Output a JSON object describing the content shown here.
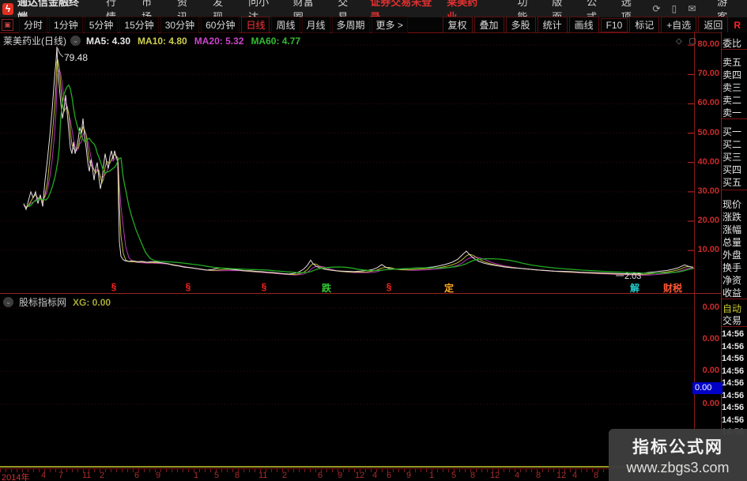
{
  "menubar": {
    "brand": "通达信金融终端",
    "items": [
      "行情",
      "市场",
      "资讯",
      "发现",
      "问小达",
      "财富圈",
      "交易"
    ],
    "status_trade": "证券交易未登录",
    "status_stock": "莱美药业",
    "right_items": [
      "功能",
      "版面",
      "公式",
      "选项"
    ],
    "icons": [
      {
        "name": "refresh-icon",
        "glyph": "⟳"
      },
      {
        "name": "phone-icon",
        "glyph": "▯"
      },
      {
        "name": "mail-icon",
        "glyph": "✉"
      }
    ],
    "user": "游客",
    "logo_glyph": "ϟ"
  },
  "toolbar": {
    "left_icon_glyph": "▣",
    "periods": [
      "分时",
      "1分钟",
      "5分钟",
      "15分钟",
      "30分钟",
      "60分钟",
      "日线",
      "周线",
      "月线",
      "多周期",
      "更多 >"
    ],
    "active_period": "日线",
    "buttons": [
      "复权",
      "叠加",
      "多股",
      "统计",
      "画线",
      "F10",
      "标记",
      "+自选",
      "返回"
    ],
    "r_badge": "R"
  },
  "chart": {
    "title": "莱美药业(日线)",
    "ma": [
      {
        "label": "MA5: 4.30",
        "color": "#e8e8e8"
      },
      {
        "label": "MA10: 4.80",
        "color": "#cfcf4f"
      },
      {
        "label": "MA20: 5.32",
        "color": "#cc44cc"
      },
      {
        "label": "MA60: 4.77",
        "color": "#33bb33"
      }
    ],
    "peak_label": "79.48",
    "low_label": "2.03",
    "y_ticks": [
      80,
      70,
      60,
      50,
      40,
      30,
      20,
      10
    ],
    "markers": [
      {
        "t": "§",
        "x": 144,
        "c": "#ff2222"
      },
      {
        "t": "§",
        "x": 238,
        "c": "#ff2222"
      },
      {
        "t": "§",
        "x": 334,
        "c": "#ff2222"
      },
      {
        "t": "跌",
        "x": 413,
        "c": "#33cc33"
      },
      {
        "t": "§",
        "x": 492,
        "c": "#ff2222"
      },
      {
        "t": "定",
        "x": 568,
        "c": "#ffaa22"
      },
      {
        "t": "解",
        "x": 803,
        "c": "#22cccc"
      },
      {
        "t": "财税",
        "x": 851,
        "c": "#ff5533"
      }
    ],
    "chart_data": {
      "type": "line",
      "title": "莱美药业 日线 close price",
      "ylim": [
        0,
        84
      ],
      "y_gridlines": [
        80,
        70,
        60,
        50,
        40,
        30,
        20,
        10
      ],
      "annotations": [
        {
          "text": "79.48",
          "x": 72
        },
        {
          "text": "2.03",
          "x": 806
        }
      ],
      "series": [
        {
          "name": "close",
          "points": [
            [
              30,
              26
            ],
            [
              33,
              24
            ],
            [
              36,
              27
            ],
            [
              39,
              30
            ],
            [
              42,
              28
            ],
            [
              45,
              30
            ],
            [
              48,
              26
            ],
            [
              51,
              29
            ],
            [
              54,
              25
            ],
            [
              57,
              34
            ],
            [
              60,
              41
            ],
            [
              63,
              49
            ],
            [
              66,
              58
            ],
            [
              69,
              69
            ],
            [
              71,
              75
            ],
            [
              72,
              79.5
            ],
            [
              73,
              72
            ],
            [
              75,
              66
            ],
            [
              77,
              60
            ],
            [
              79,
              55
            ],
            [
              81,
              58
            ],
            [
              83,
              63
            ],
            [
              85,
              57
            ],
            [
              87,
              51
            ],
            [
              89,
              45
            ],
            [
              91,
              43
            ],
            [
              93,
              47
            ],
            [
              95,
              43
            ],
            [
              97,
              45
            ],
            [
              99,
              48
            ],
            [
              101,
              52
            ],
            [
              103,
              50
            ],
            [
              105,
              55
            ],
            [
              107,
              49
            ],
            [
              109,
              45
            ],
            [
              111,
              40
            ],
            [
              113,
              37
            ],
            [
              115,
              41
            ],
            [
              117,
              38
            ],
            [
              119,
              34
            ],
            [
              121,
              38
            ],
            [
              123,
              40
            ],
            [
              125,
              35
            ],
            [
              127,
              31
            ],
            [
              129,
              34
            ],
            [
              131,
              39
            ],
            [
              133,
              43
            ],
            [
              135,
              40
            ],
            [
              137,
              38
            ],
            [
              139,
              42
            ],
            [
              141,
              44
            ],
            [
              143,
              41
            ],
            [
              145,
              44
            ],
            [
              147,
              42
            ],
            [
              149,
              40
            ],
            [
              150,
              25
            ],
            [
              151,
              13
            ],
            [
              153,
              8
            ],
            [
              156,
              6.8
            ],
            [
              159,
              6.4
            ],
            [
              163,
              6.3
            ],
            [
              168,
              6.5
            ],
            [
              174,
              6.2
            ],
            [
              180,
              6.3
            ],
            [
              186,
              6.0
            ],
            [
              192,
              6.2
            ],
            [
              198,
              6.1
            ],
            [
              205,
              5.8
            ],
            [
              212,
              5.5
            ],
            [
              219,
              5.0
            ],
            [
              226,
              4.7
            ],
            [
              233,
              4.3
            ],
            [
              240,
              4.2
            ],
            [
              247,
              3.9
            ],
            [
              254,
              3.6
            ],
            [
              261,
              3.3
            ],
            [
              268,
              3.5
            ],
            [
              275,
              3.9
            ],
            [
              282,
              4.0
            ],
            [
              289,
              3.7
            ],
            [
              296,
              3.5
            ],
            [
              303,
              3.3
            ],
            [
              310,
              3.1
            ],
            [
              317,
              3.1
            ],
            [
              324,
              2.9
            ],
            [
              331,
              2.8
            ],
            [
              338,
              2.6
            ],
            [
              345,
              2.5
            ],
            [
              352,
              2.3
            ],
            [
              359,
              2.1
            ],
            [
              366,
              2.0
            ],
            [
              372,
              2.2
            ],
            [
              378,
              2.7
            ],
            [
              384,
              3.6
            ],
            [
              389,
              5.0
            ],
            [
              393,
              6.7
            ],
            [
              396,
              5.5
            ],
            [
              400,
              4.6
            ],
            [
              405,
              4.0
            ],
            [
              411,
              3.6
            ],
            [
              418,
              3.3
            ],
            [
              425,
              3.1
            ],
            [
              432,
              3.0
            ],
            [
              440,
              2.9
            ],
            [
              448,
              2.8
            ],
            [
              456,
              3.0
            ],
            [
              464,
              3.2
            ],
            [
              471,
              3.5
            ],
            [
              477,
              4.1
            ],
            [
              483,
              5.2
            ],
            [
              488,
              4.3
            ],
            [
              494,
              3.8
            ],
            [
              501,
              3.6
            ],
            [
              508,
              3.7
            ],
            [
              516,
              3.8
            ],
            [
              524,
              4.0
            ],
            [
              532,
              4.1
            ],
            [
              540,
              4.2
            ],
            [
              548,
              4.4
            ],
            [
              556,
              4.8
            ],
            [
              564,
              5.3
            ],
            [
              572,
              6.0
            ],
            [
              579,
              7.0
            ],
            [
              585,
              8.6
            ],
            [
              590,
              9.8
            ],
            [
              594,
              8.6
            ],
            [
              599,
              7.4
            ],
            [
              605,
              6.4
            ],
            [
              612,
              5.7
            ],
            [
              620,
              5.2
            ],
            [
              629,
              4.8
            ],
            [
              638,
              4.4
            ],
            [
              648,
              4.1
            ],
            [
              658,
              3.9
            ],
            [
              668,
              3.7
            ],
            [
              679,
              3.4
            ],
            [
              690,
              3.2
            ],
            [
              701,
              3.0
            ],
            [
              712,
              2.9
            ],
            [
              723,
              2.8
            ],
            [
              734,
              2.6
            ],
            [
              745,
              2.5
            ],
            [
              756,
              2.4
            ],
            [
              767,
              2.3
            ],
            [
              778,
              2.2
            ],
            [
              789,
              2.1
            ],
            [
              800,
              2.05
            ],
            [
              806,
              2.03
            ],
            [
              813,
              2.2
            ],
            [
              820,
              2.5
            ],
            [
              828,
              2.7
            ],
            [
              836,
              3.0
            ],
            [
              844,
              3.2
            ],
            [
              851,
              3.6
            ],
            [
              857,
              4.0
            ],
            [
              862,
              4.6
            ],
            [
              866,
              5.1
            ],
            [
              870,
              4.7
            ],
            [
              874,
              4.4
            ],
            [
              877,
              4.3
            ]
          ]
        }
      ]
    }
  },
  "corner_icons": "◇ ▢",
  "indicator": {
    "name": "股标指标网",
    "value": "XG: 0.00",
    "levels": [
      {
        "t": "0.00",
        "y": 390
      },
      {
        "t": "0.00",
        "y": 430
      },
      {
        "t": "0.00",
        "y": 470
      },
      {
        "t": "0.00",
        "y": 512
      }
    ],
    "tag_value": "0.00"
  },
  "quote_panel": {
    "rows": [
      {
        "t": "委比",
        "y": 46
      },
      {
        "t": "卖五",
        "y": 70
      },
      {
        "t": "卖四",
        "y": 86
      },
      {
        "t": "卖三",
        "y": 102
      },
      {
        "t": "卖二",
        "y": 118
      },
      {
        "t": "卖一",
        "y": 134
      },
      {
        "t": "买一",
        "y": 158
      },
      {
        "t": "买二",
        "y": 174
      },
      {
        "t": "买三",
        "y": 190
      },
      {
        "t": "买四",
        "y": 206
      },
      {
        "t": "买五",
        "y": 222
      },
      {
        "t": "现价",
        "y": 250
      },
      {
        "t": "涨跌",
        "y": 266
      },
      {
        "t": "涨幅",
        "y": 282
      },
      {
        "t": "总量",
        "y": 298
      },
      {
        "t": "外盘",
        "y": 314
      },
      {
        "t": "换手",
        "y": 330
      },
      {
        "t": "净资",
        "y": 346
      },
      {
        "t": "收益",
        "y": 362
      },
      {
        "t": "自动",
        "y": 382,
        "c": "#cccc33"
      },
      {
        "t": "交易",
        "y": 397
      }
    ],
    "separators": [
      62,
      150,
      240,
      378,
      413
    ],
    "times": [
      "14:56",
      "14:56",
      "14:56",
      "14:56",
      "14:56",
      "14:56",
      "14:56",
      "14:56",
      "14:56"
    ]
  },
  "date_axis": {
    "labels": [
      {
        "t": "2014年",
        "x": 2,
        "year": true
      },
      {
        "t": "4",
        "x": 52
      },
      {
        "t": "7",
        "x": 74
      },
      {
        "t": "11",
        "x": 104
      },
      {
        "t": "2",
        "x": 126
      },
      {
        "t": "6",
        "x": 170
      },
      {
        "t": "9",
        "x": 197
      },
      {
        "t": "1",
        "x": 245
      },
      {
        "t": "5",
        "x": 271
      },
      {
        "t": "8",
        "x": 297
      },
      {
        "t": "11",
        "x": 327
      },
      {
        "t": "2",
        "x": 357
      },
      {
        "t": "6",
        "x": 402
      },
      {
        "t": "9",
        "x": 427
      },
      {
        "t": "12",
        "x": 449
      },
      {
        "t": "4",
        "x": 471
      },
      {
        "t": "6",
        "x": 489
      },
      {
        "t": "9",
        "x": 514
      },
      {
        "t": "1",
        "x": 543
      },
      {
        "t": "5",
        "x": 571
      },
      {
        "t": "8",
        "x": 595
      },
      {
        "t": "12",
        "x": 620
      },
      {
        "t": "4",
        "x": 651
      },
      {
        "t": "8",
        "x": 678
      },
      {
        "t": "12",
        "x": 704
      },
      {
        "t": "4",
        "x": 724
      },
      {
        "t": "8",
        "x": 751
      }
    ]
  },
  "watermark": {
    "title": "指标公式网",
    "url": "www.zbgs3.com"
  }
}
